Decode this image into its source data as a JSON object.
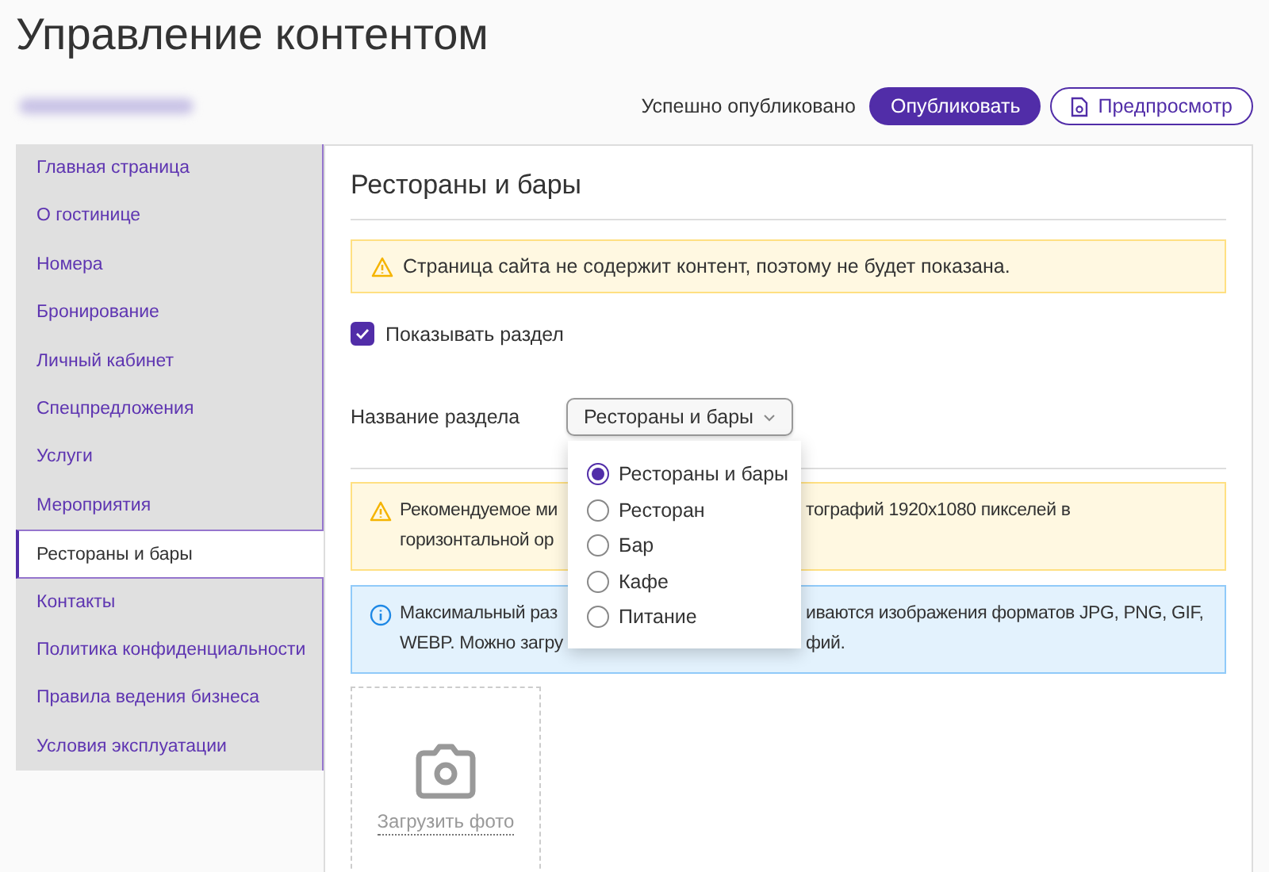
{
  "page_title": "Управление контентом",
  "toolbar": {
    "status": "Успешно опубликовано",
    "buttons": [
      {
        "label": "Опубликовать",
        "kind": "primary"
      },
      {
        "label": "Предпросмотр",
        "kind": "outline"
      }
    ]
  },
  "sidebar": {
    "items": [
      {
        "label": "Главная страница",
        "selected": false
      },
      {
        "label": "О гостинице",
        "selected": false
      },
      {
        "label": "Номера",
        "selected": false
      },
      {
        "label": "Бронирование",
        "selected": false
      },
      {
        "label": "Личный кабинет",
        "selected": false
      },
      {
        "label": "Спецпредложения",
        "selected": false
      },
      {
        "label": "Услуги",
        "selected": false
      },
      {
        "label": "Мероприятия",
        "selected": false
      },
      {
        "label": "Рестораны и бары",
        "selected": true
      },
      {
        "label": "Контакты",
        "selected": false
      },
      {
        "label": "Политика конфиденциальности",
        "selected": false
      },
      {
        "label": "Правила ведения бизнеса",
        "selected": false
      },
      {
        "label": "Условия эксплуатации",
        "selected": false
      }
    ]
  },
  "section": {
    "title": "Рестораны и бары",
    "alert": {
      "kind": "warning",
      "text": "Страница сайта не содержит контент, поэтому не будет показана."
    },
    "show_section": {
      "label": "Показывать раздел",
      "checked": true
    },
    "name_field": {
      "label": "Название раздела",
      "value": "Рестораны и бары",
      "expanded": true,
      "options": [
        {
          "label": "Рестораны и бары",
          "selected": true
        },
        {
          "label": "Ресторан",
          "selected": false
        },
        {
          "label": "Бар",
          "selected": false
        },
        {
          "label": "Кафе",
          "selected": false
        },
        {
          "label": "Питание",
          "selected": false
        }
      ]
    },
    "notes": [
      {
        "kind": "warning",
        "lines": [
          {
            "left": "Рекомендуемое ми",
            "right": "тографий 1920x1080 пикселей в"
          },
          {
            "left": "горизонтальной ор"
          }
        ]
      },
      {
        "kind": "info",
        "lines": [
          {
            "left": "Максимальный раз",
            "right": "иваются изображения форматов JPG, PNG, GIF,"
          },
          {
            "left": "WEBP. Можно загру",
            "right": "фий."
          }
        ]
      }
    ],
    "upload": {
      "label": "Загрузить фото"
    }
  }
}
